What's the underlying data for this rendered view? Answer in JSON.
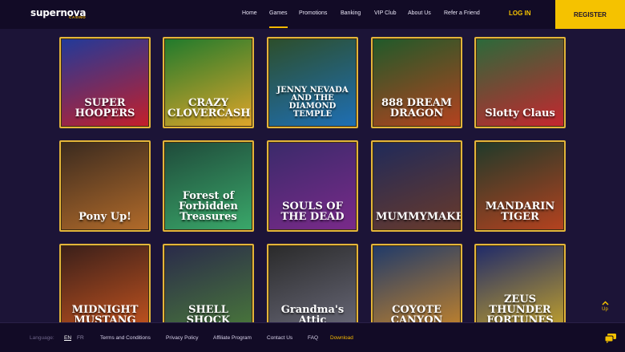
{
  "brand": {
    "name": "supernova",
    "sub": "CASINO"
  },
  "nav": [
    {
      "label": "Home"
    },
    {
      "label": "Games"
    },
    {
      "label": "Promotions"
    },
    {
      "label": "Banking"
    },
    {
      "label": "VIP Club"
    },
    {
      "label": "About Us"
    },
    {
      "label": "Refer a Friend"
    }
  ],
  "auth": {
    "login": "LOG IN",
    "register": "REGISTER"
  },
  "games": [
    {
      "title": "SUPER HOOPERS",
      "colors": [
        "#203a9a",
        "#c51f2a"
      ]
    },
    {
      "title": "CRAZY CLOVERCASH",
      "colors": [
        "#1f7a2c",
        "#e0a52a"
      ]
    },
    {
      "title": "JENNY NEVADA AND THE DIAMOND TEMPLE",
      "colors": [
        "#2d4e2a",
        "#1e6fb5"
      ]
    },
    {
      "title": "888 DREAM DRAGON",
      "colors": [
        "#1f5a2a",
        "#b5421f"
      ]
    },
    {
      "title": "Slotty Claus",
      "colors": [
        "#2a6a3a",
        "#c7262f"
      ]
    },
    {
      "title": "Pony Up!",
      "colors": [
        "#3a2a1f",
        "#b26b2a"
      ]
    },
    {
      "title": "Forest of Forbidden Treasures",
      "colors": [
        "#1f4a3a",
        "#3aa86a"
      ]
    },
    {
      "title": "SOULS OF THE DEAD",
      "colors": [
        "#3a2a6a",
        "#7a2a8a"
      ]
    },
    {
      "title": "MUMMYMAKER",
      "colors": [
        "#1f2a5a",
        "#6a3a2a"
      ]
    },
    {
      "title": "MANDARIN TIGER",
      "colors": [
        "#1f3a2a",
        "#b5421f"
      ]
    },
    {
      "title": "MIDNIGHT MUSTANG",
      "colors": [
        "#3a1f1a",
        "#c7551f"
      ]
    },
    {
      "title": "SHELL SHOCK",
      "colors": [
        "#2a2a4a",
        "#4a7a3a"
      ]
    },
    {
      "title": "Grandma's Attic",
      "colors": [
        "#2a2a2a",
        "#6a6a7a"
      ]
    },
    {
      "title": "COYOTE CANYON",
      "colors": [
        "#1f3a6a",
        "#c7852a"
      ]
    },
    {
      "title": "ZEUS THUNDER FORTUNES",
      "colors": [
        "#1f2a6a",
        "#c7a52a"
      ]
    }
  ],
  "footer": {
    "language_label": "Language:",
    "lang_en": "EN",
    "lang_fr": "FR",
    "links": [
      {
        "label": "Terms and Conditions"
      },
      {
        "label": "Privacy Policy"
      },
      {
        "label": "Affiliate Program"
      },
      {
        "label": "Contact Us"
      },
      {
        "label": "FAQ"
      },
      {
        "label": "Download"
      }
    ]
  },
  "up": {
    "label": "Up"
  },
  "icons": {
    "up": "chevron-up-icon",
    "chat": "chat-icon"
  },
  "accent": "#f5c200"
}
